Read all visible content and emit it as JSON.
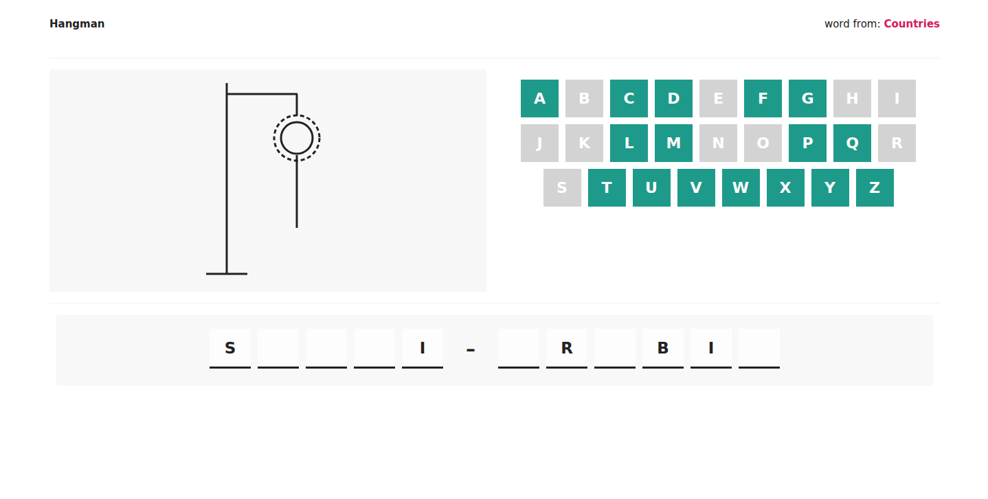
{
  "header": {
    "title": "Hangman",
    "source_label": "word from:",
    "category": "Countries"
  },
  "figure": {
    "parts": [
      {
        "kind": "base",
        "shown": true
      },
      {
        "kind": "pole",
        "shown": true
      },
      {
        "kind": "beam",
        "shown": true
      },
      {
        "kind": "rope",
        "shown": true
      },
      {
        "kind": "head",
        "shown": true
      },
      {
        "kind": "body",
        "shown": true
      },
      {
        "kind": "left-arm",
        "shown": false
      },
      {
        "kind": "right-arm",
        "shown": false
      },
      {
        "kind": "left-leg",
        "shown": false
      },
      {
        "kind": "right-leg",
        "shown": false
      }
    ]
  },
  "keyboard": {
    "rows": [
      [
        {
          "key": "A",
          "used": false
        },
        {
          "key": "B",
          "used": true
        },
        {
          "key": "C",
          "used": false
        },
        {
          "key": "D",
          "used": false
        },
        {
          "key": "E",
          "used": true
        },
        {
          "key": "F",
          "used": false
        },
        {
          "key": "G",
          "used": false
        },
        {
          "key": "H",
          "used": true
        },
        {
          "key": "I",
          "used": true
        }
      ],
      [
        {
          "key": "J",
          "used": true
        },
        {
          "key": "K",
          "used": true
        },
        {
          "key": "L",
          "used": false
        },
        {
          "key": "M",
          "used": false
        },
        {
          "key": "N",
          "used": true
        },
        {
          "key": "O",
          "used": true
        },
        {
          "key": "P",
          "used": false
        },
        {
          "key": "Q",
          "used": false
        },
        {
          "key": "R",
          "used": true
        }
      ],
      [
        {
          "key": "S",
          "used": true
        },
        {
          "key": "T",
          "used": false
        },
        {
          "key": "U",
          "used": false
        },
        {
          "key": "V",
          "used": false
        },
        {
          "key": "W",
          "used": false
        },
        {
          "key": "X",
          "used": false
        },
        {
          "key": "Y",
          "used": false
        },
        {
          "key": "Z",
          "used": false
        }
      ]
    ]
  },
  "word": [
    {
      "kind": "letter",
      "char": "S",
      "revealed": true
    },
    {
      "kind": "letter",
      "char": "",
      "revealed": false
    },
    {
      "kind": "letter",
      "char": "",
      "revealed": false
    },
    {
      "kind": "letter",
      "char": "",
      "revealed": false
    },
    {
      "kind": "letter",
      "char": "I",
      "revealed": true
    },
    {
      "kind": "dash",
      "char": "–",
      "revealed": true
    },
    {
      "kind": "letter",
      "char": "",
      "revealed": false
    },
    {
      "kind": "letter",
      "char": "R",
      "revealed": true
    },
    {
      "kind": "letter",
      "char": "",
      "revealed": false
    },
    {
      "kind": "letter",
      "char": "B",
      "revealed": true
    },
    {
      "kind": "letter",
      "char": "I",
      "revealed": true
    },
    {
      "kind": "letter",
      "char": "",
      "revealed": false
    }
  ]
}
